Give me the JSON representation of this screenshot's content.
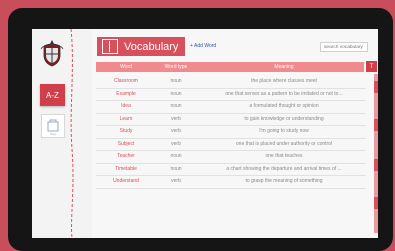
{
  "sidebar": {
    "az_label": "A-Z",
    "bag_label": "Bag"
  },
  "header": {
    "title": "Vocabulary",
    "add_word": "+ Add Word",
    "search_placeholder": "search vocabulary"
  },
  "table": {
    "columns": [
      "Word",
      "Word type",
      "Meaning"
    ],
    "filter_label": "T",
    "rows": [
      {
        "word": "Classroom",
        "type": "noun",
        "meaning": "the place where classes meet"
      },
      {
        "word": "Example",
        "type": "noun",
        "meaning": "one that serves as a pattern to be imitated or not to..."
      },
      {
        "word": "Idea",
        "type": "noun",
        "meaning": "a formulated thought or opinion"
      },
      {
        "word": "Learn",
        "type": "verb",
        "meaning": "to gain knowledge or understanding"
      },
      {
        "word": "Study",
        "type": "verb",
        "meaning": "I'm going to study now"
      },
      {
        "word": "Subject",
        "type": "verb",
        "meaning": "one that is placed under authority or control"
      },
      {
        "word": "Teacher",
        "type": "noun",
        "meaning": "one that teaches"
      },
      {
        "word": "Timetable",
        "type": "noun",
        "meaning": "a chart showing the departure and arrival times of ..."
      },
      {
        "word": "Understand",
        "type": "verb",
        "meaning": "to grasp the meaning of something"
      }
    ]
  },
  "colors": {
    "background": "#c84e5b",
    "accent": "#d8505c",
    "header": "#f08a8f"
  }
}
